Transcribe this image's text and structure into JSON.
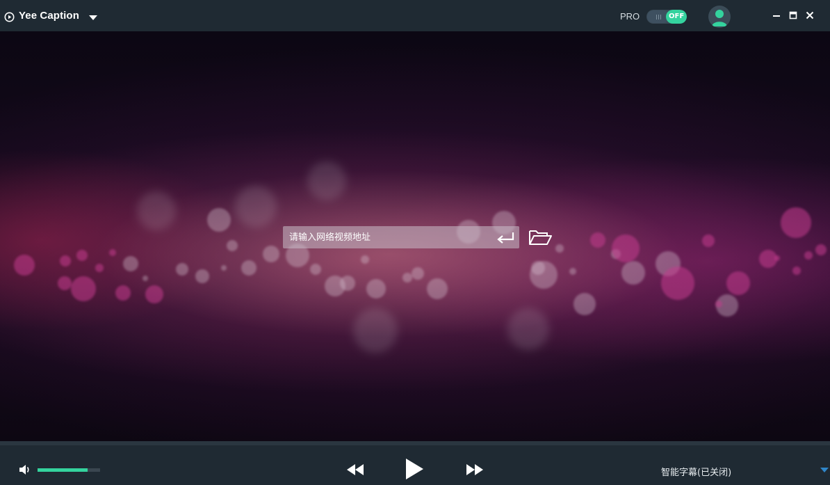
{
  "app": {
    "title": "Yee Caption",
    "logo_icon": "play-circle-icon",
    "menu_icon": "caret-down-icon"
  },
  "pro": {
    "label": "PRO",
    "toggle_state": "OFF",
    "toggle_color": "#34d39e"
  },
  "window_controls": [
    "minimize-icon",
    "maximize-icon",
    "close-icon"
  ],
  "url_input": {
    "placeholder": "请输入网络视频地址",
    "value": ""
  },
  "player": {
    "volume_level": 0.8,
    "accent_color": "#34d39e",
    "controls": [
      "rewind-icon",
      "play-icon",
      "fast-forward-icon"
    ],
    "subtitle_status": "智能字幕(已关闭)"
  }
}
